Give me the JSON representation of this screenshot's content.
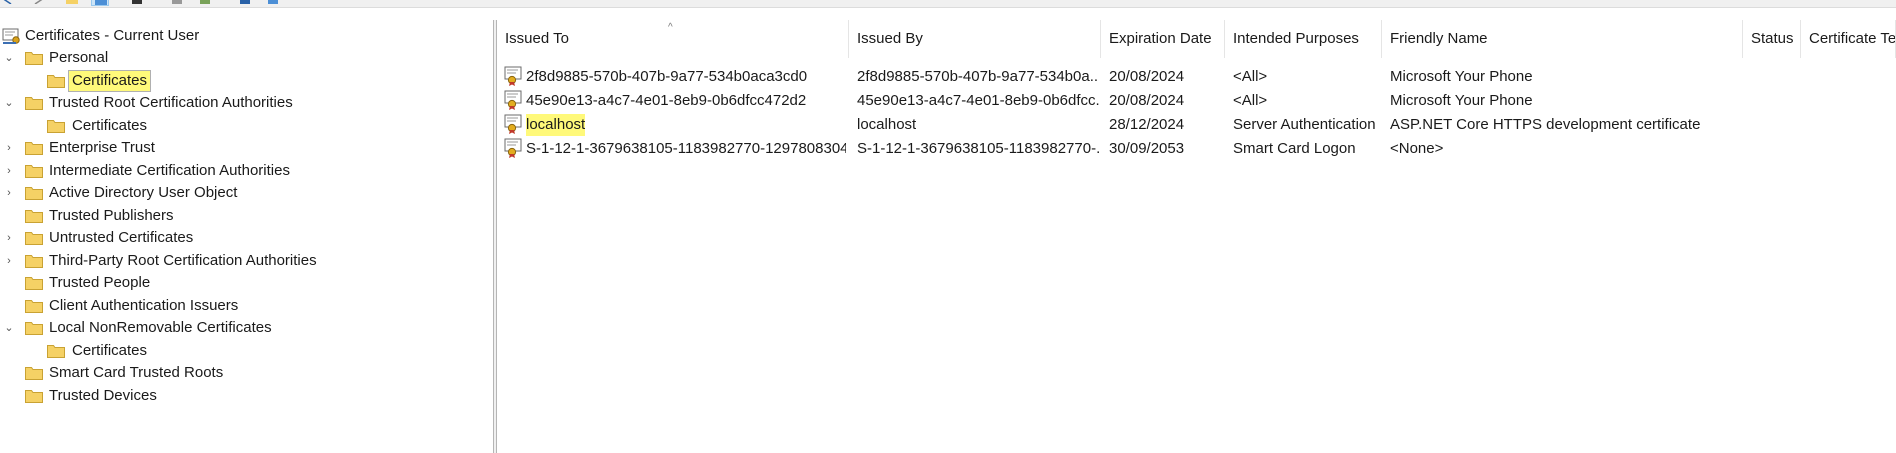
{
  "toolbar": {
    "buttons": [
      "back-icon",
      "forward-icon",
      "folder-icon",
      "details-view-icon",
      "print-icon",
      "properties-icon",
      "export-icon",
      "help-icon",
      "console-icon"
    ]
  },
  "tree": {
    "root": {
      "label": "Certificates - Current User",
      "icon": "certificate-store-icon"
    },
    "items": [
      {
        "label": "Personal",
        "expanded": true,
        "level": 1
      },
      {
        "label": "Certificates",
        "level": 2,
        "selected": true,
        "highlighted": true
      },
      {
        "label": "Trusted Root Certification Authorities",
        "expanded": true,
        "level": 1
      },
      {
        "label": "Certificates",
        "level": 2
      },
      {
        "label": "Enterprise Trust",
        "expandable": true,
        "level": 1
      },
      {
        "label": "Intermediate Certification Authorities",
        "expandable": true,
        "level": 1
      },
      {
        "label": "Active Directory User Object",
        "expandable": true,
        "level": 1
      },
      {
        "label": "Trusted Publishers",
        "level": 1
      },
      {
        "label": "Untrusted Certificates",
        "expandable": true,
        "level": 1
      },
      {
        "label": "Third-Party Root Certification Authorities",
        "expandable": true,
        "level": 1
      },
      {
        "label": "Trusted People",
        "level": 1
      },
      {
        "label": "Client Authentication Issuers",
        "level": 1
      },
      {
        "label": "Local NonRemovable Certificates",
        "expanded": true,
        "level": 1
      },
      {
        "label": "Certificates",
        "level": 2
      },
      {
        "label": "Smart Card Trusted Roots",
        "level": 1
      },
      {
        "label": "Trusted Devices",
        "level": 1
      }
    ]
  },
  "list": {
    "columns": [
      "Issued To",
      "Issued By",
      "Expiration Date",
      "Intended Purposes",
      "Friendly Name",
      "Status",
      "Certificate Te"
    ],
    "sort_indicator": "^",
    "rows": [
      {
        "issued_to": "2f8d9885-570b-407b-9a77-534b0aca3cd0",
        "issued_by": "2f8d9885-570b-407b-9a77-534b0a...",
        "expiration": "20/08/2024",
        "purposes": "<All>",
        "friendly": "Microsoft Your Phone",
        "status": "",
        "template": ""
      },
      {
        "issued_to": "45e90e13-a4c7-4e01-8eb9-0b6dfcc472d2",
        "issued_by": "45e90e13-a4c7-4e01-8eb9-0b6dfcc...",
        "expiration": "20/08/2024",
        "purposes": "<All>",
        "friendly": "Microsoft Your Phone",
        "status": "",
        "template": ""
      },
      {
        "issued_to": "localhost",
        "issued_by": "localhost",
        "expiration": "28/12/2024",
        "purposes": "Server Authentication",
        "friendly": "ASP.NET Core HTTPS development certificate",
        "status": "",
        "template": "",
        "highlighted": true
      },
      {
        "issued_to": "S-1-12-1-3679638105-1183982770-1297808304-...",
        "issued_by": "S-1-12-1-3679638105-1183982770-...",
        "expiration": "30/09/2053",
        "purposes": "Smart Card Logon",
        "friendly": "<None>",
        "status": "",
        "template": ""
      }
    ]
  },
  "colors": {
    "highlight": "#fff97a",
    "selection": "#d9d9d9",
    "folder": "#f5d165"
  }
}
